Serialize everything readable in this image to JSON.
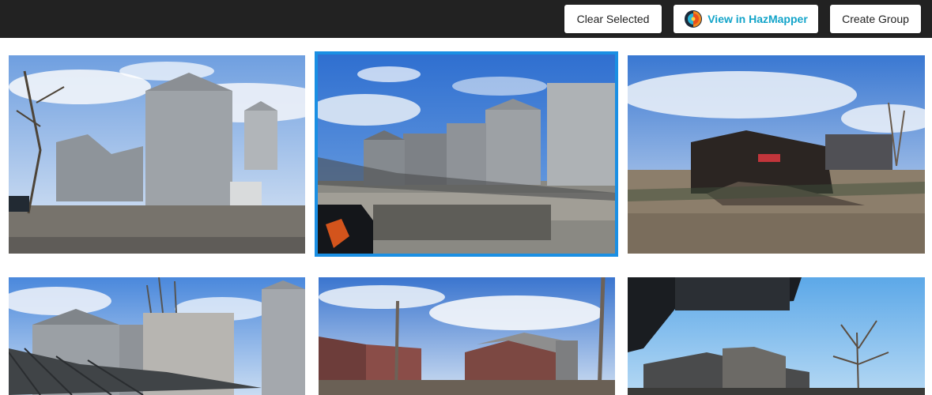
{
  "toolbar": {
    "clear_label": "Clear Selected",
    "hazmapper_label": "View in HazMapper",
    "create_label": "Create Group"
  },
  "colors": {
    "topbar": "#222222",
    "accent": "#13a4c9",
    "selection": "#1a8fe3"
  },
  "photos": [
    {
      "subject": "grain-silos-damaged",
      "selected": false
    },
    {
      "subject": "grain-silos-debris",
      "selected": true
    },
    {
      "subject": "collapsed-building",
      "selected": false
    },
    {
      "subject": "grain-elevator-wreckage",
      "selected": false
    },
    {
      "subject": "damaged-houses",
      "selected": false
    },
    {
      "subject": "damaged-house-car-view",
      "selected": false
    }
  ]
}
